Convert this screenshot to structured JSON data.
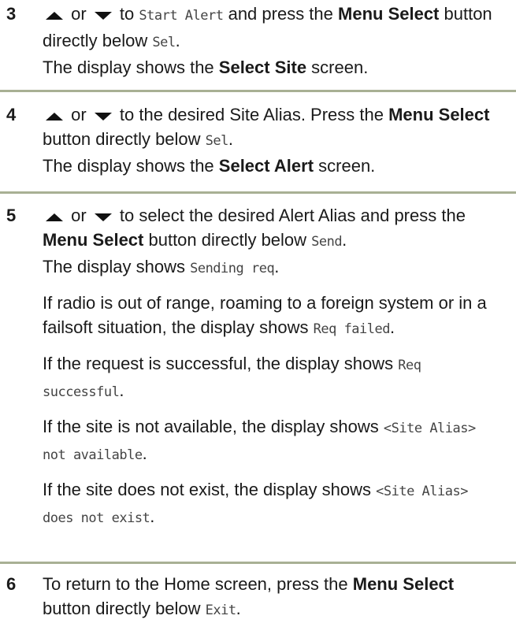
{
  "steps": [
    {
      "num": "3",
      "p1_pre": " or ",
      "p1_mid": " to ",
      "p1_code": "Start Alert",
      "p1_post": " and press the ",
      "p1_bold": "Menu Select",
      "p1_tail": " button directly below ",
      "p1_code2": "Sel",
      "p1_end": ".",
      "p2_pre": "The display shows the ",
      "p2_bold": "Select Site",
      "p2_end": " screen."
    },
    {
      "num": "4",
      "p1_pre": " or ",
      "p1_mid": " to the desired Site Alias. Press the ",
      "p1_bold": "Menu Select",
      "p1_tail": " button directly below ",
      "p1_code": "Sel",
      "p1_end": ".",
      "p2_pre": "The display shows the ",
      "p2_bold": "Select Alert",
      "p2_end": " screen."
    },
    {
      "num": "5",
      "p1_pre": " or ",
      "p1_mid": " to select the desired Alert Alias and press the ",
      "p1_bold": "Menu Select",
      "p1_tail": " button directly below ",
      "p1_code": "Send",
      "p1_end": ".",
      "p2_pre": "The display shows ",
      "p2_code": "Sending req",
      "p2_end": ".",
      "p3_pre": "If radio is out of range, roaming to a foreign system or in a failsoft situation, the display shows ",
      "p3_code": "Req failed",
      "p3_end": ".",
      "p4_pre": "If the request is successful, the display shows ",
      "p4_code": "Req successful",
      "p4_end": ".",
      "p5_pre": "If the site is not available, the display shows ",
      "p5_code": "<Site Alias> not available",
      "p5_end": ".",
      "p6_pre": "If the site does not exist, the display shows ",
      "p6_code": "<Site Alias> does not exist",
      "p6_end": "."
    },
    {
      "num": "6",
      "p1_pre": "To return to the Home screen, press the ",
      "p1_bold": "Menu Select",
      "p1_tail": " button directly below ",
      "p1_code": "Exit",
      "p1_end": "."
    }
  ],
  "icons": {
    "up": "up-arrow-icon",
    "down": "down-arrow-icon"
  },
  "colors": {
    "rule": "#a8b094",
    "text": "#1a1a1a"
  }
}
